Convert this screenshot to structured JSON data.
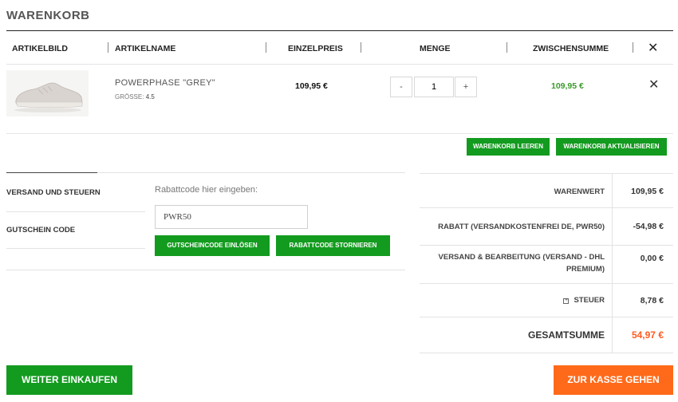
{
  "page": {
    "title": "WARENKORB"
  },
  "table": {
    "headers": {
      "image": "ARTIKELBILD",
      "name": "ARTIKELNAME",
      "unit_price": "EINZELPREIS",
      "quantity": "MENGE",
      "subtotal": "ZWISCHENSUMME"
    },
    "close_icon": "close-icon"
  },
  "item": {
    "name": "POWERPHASE \"GREY\"",
    "size_label": "GRÖSSE:",
    "size_value": "4.5",
    "unit_price": "109,95 €",
    "qty_minus": "-",
    "qty_value": "1",
    "qty_plus": "+",
    "subtotal": "109,95 €"
  },
  "cart_actions": {
    "empty": "WARENKORB LEEREN",
    "update": "WARENKORB AKTUALISIEREN"
  },
  "sidebar": {
    "items": [
      {
        "label": "VERSAND UND STEUERN"
      },
      {
        "label": "GUTSCHEIN CODE"
      }
    ]
  },
  "coupon": {
    "label": "Rabattcode hier eingeben:",
    "value": "PWR50",
    "redeem": "GUTSCHEINCODE EINLÖSEN",
    "cancel": "RABATTCODE STORNIEREN"
  },
  "totals": {
    "goods_label": "WARENWERT",
    "goods_value": "109,95 €",
    "discount_label": "RABATT (VERSANDKOSTENFREI DE, PWR50)",
    "discount_value": "-54,98 €",
    "shipping_label": "VERSAND & BEARBEITUNG (VERSAND - DHL PREMIUM)",
    "shipping_value": "0,00 €",
    "tax_label": "STEUER",
    "tax_value": "8,78 €",
    "total_label": "GESAMTSUMME",
    "total_value": "54,97 €"
  },
  "footer": {
    "continue": "WEITER EINKAUFEN",
    "checkout": "ZUR KASSE GEHEN"
  },
  "colors": {
    "green": "#139b1f",
    "orange": "#ff6a1a",
    "subtotal_green": "#3a9b2b",
    "total_orange": "#ff5a1f"
  }
}
